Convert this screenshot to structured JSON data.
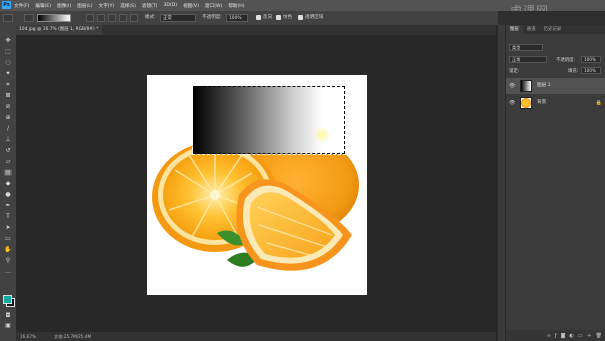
{
  "menubar": {
    "logo": "Ps",
    "items": [
      "文件(F)",
      "编辑(E)",
      "图像(I)",
      "图层(L)",
      "文字(Y)",
      "选择(S)",
      "滤镜(T)",
      "3D(D)",
      "视图(V)",
      "窗口(W)",
      "帮助(H)"
    ]
  },
  "options": {
    "mode_label": "模式:",
    "mode_value": "正常",
    "opacity_label": "不透明度:",
    "opacity_value": "100%",
    "reverse_label": "反向",
    "dither_label": "仿色",
    "transparency_label": "透明区域"
  },
  "document": {
    "tab_title": "104.jpg @ 16.7% (图层 1, RGB/8#) *",
    "zoom": "16.67%",
    "status": "文档:25.7M/25.4M"
  },
  "panels": {
    "tabs": [
      "图层",
      "通道",
      "历史记录"
    ],
    "kind_label": "类型",
    "blend_mode": "正常",
    "opacity_label": "不透明度:",
    "opacity_value": "100%",
    "lock_label": "锁定:",
    "fill_label": "填充:",
    "fill_value": "100%",
    "layers": [
      {
        "name": "图层 1"
      },
      {
        "name": "背景"
      }
    ]
  },
  "watermark": "虎课网",
  "colors": {
    "foreground": "#10a7a1",
    "background": "#1a1a1a",
    "accent": "#31a8ff"
  }
}
